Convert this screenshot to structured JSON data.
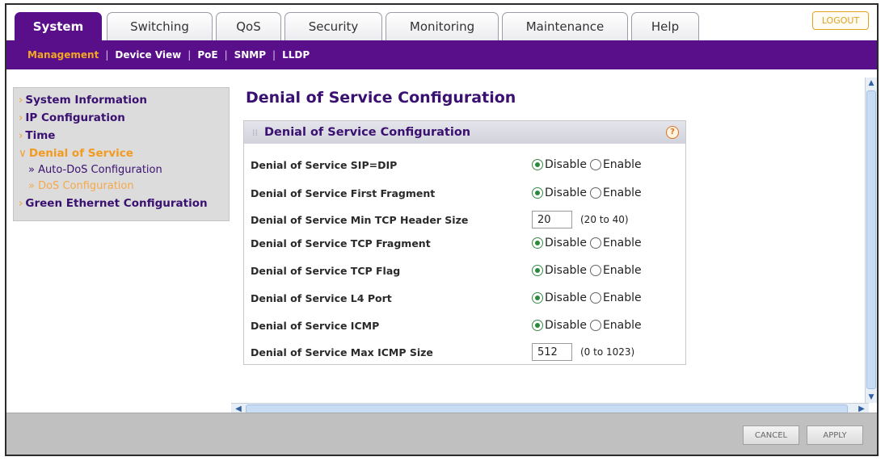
{
  "top_tabs": [
    {
      "label": "System",
      "active": true
    },
    {
      "label": "Switching",
      "active": false
    },
    {
      "label": "QoS",
      "active": false
    },
    {
      "label": "Security",
      "active": false
    },
    {
      "label": "Monitoring",
      "active": false
    },
    {
      "label": "Maintenance",
      "active": false
    },
    {
      "label": "Help",
      "active": false
    }
  ],
  "logout_label": "LOGOUT",
  "subnav": [
    {
      "label": "Management",
      "active": true
    },
    {
      "label": "Device View",
      "active": false
    },
    {
      "label": "PoE",
      "active": false
    },
    {
      "label": "SNMP",
      "active": false
    },
    {
      "label": "LLDP",
      "active": false
    }
  ],
  "sidebar": {
    "system_information": "System Information",
    "ip_configuration": "IP Configuration",
    "time": "Time",
    "denial_of_service": "Denial of Service",
    "auto_dos": "Auto-DoS Configuration",
    "dos_config": "DoS Configuration",
    "green_ethernet": "Green Ethernet Configuration"
  },
  "page_title": "Denial of Service Configuration",
  "panel_title": "Denial of Service Configuration",
  "help_icon_text": "?",
  "options": {
    "disable": "Disable",
    "enable": "Enable"
  },
  "rows": [
    {
      "label": "Denial of Service SIP=DIP",
      "type": "radio",
      "value": "Disable"
    },
    {
      "label": "Denial of Service First Fragment",
      "type": "radio",
      "value": "Disable"
    },
    {
      "label": "Denial of Service Min TCP Header Size",
      "type": "text",
      "value": "20",
      "range": "(20 to 40)"
    },
    {
      "label": "Denial of Service TCP Fragment",
      "type": "radio",
      "value": "Disable"
    },
    {
      "label": "Denial of Service TCP Flag",
      "type": "radio",
      "value": "Disable"
    },
    {
      "label": "Denial of Service L4 Port",
      "type": "radio",
      "value": "Disable"
    },
    {
      "label": "Denial of Service ICMP",
      "type": "radio",
      "value": "Disable"
    },
    {
      "label": "Denial of Service Max ICMP Size",
      "type": "text",
      "value": "512",
      "range": "(0 to 1023)"
    }
  ],
  "buttons": {
    "cancel": "CANCEL",
    "apply": "APPLY"
  },
  "colors": {
    "brand_purple": "#5a0f8a",
    "accent_orange": "#f39a20"
  }
}
